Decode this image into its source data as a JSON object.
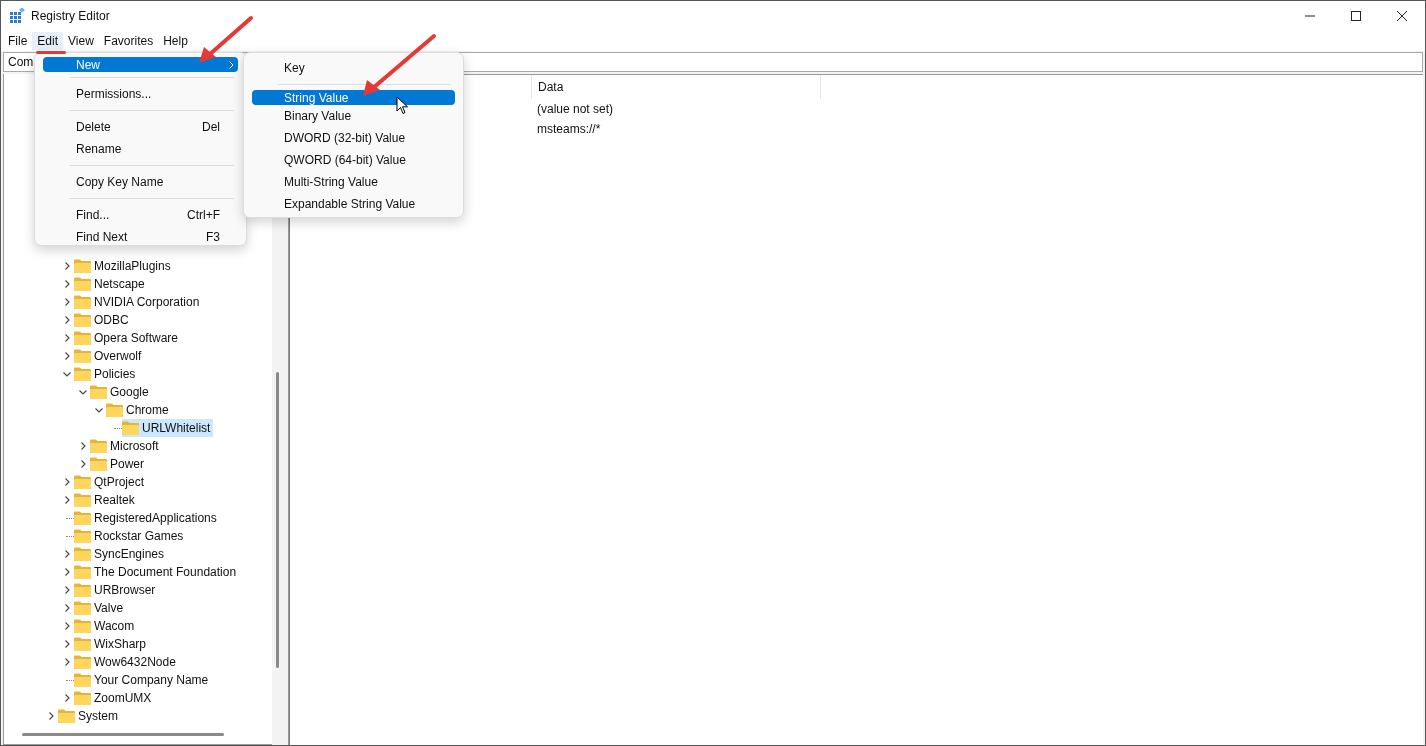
{
  "window": {
    "title": "Registry Editor"
  },
  "menu_bar": [
    {
      "label": "File",
      "selected": false
    },
    {
      "label": "Edit",
      "selected": true
    },
    {
      "label": "View",
      "selected": false
    },
    {
      "label": "Favorites",
      "selected": false
    },
    {
      "label": "Help",
      "selected": false
    }
  ],
  "address_bar": {
    "value": "Com"
  },
  "tree": [
    {
      "children": [
        {
          "label": "MozillaPlugins",
          "has_children": true,
          "expanded": false,
          "selected": false
        },
        {
          "label": "Netscape",
          "has_children": true,
          "expanded": false,
          "selected": false
        },
        {
          "label": "NVIDIA Corporation",
          "has_children": true,
          "expanded": false,
          "selected": false
        },
        {
          "label": "ODBC",
          "has_children": true,
          "expanded": false,
          "selected": false
        },
        {
          "label": "Opera Software",
          "has_children": true,
          "expanded": false,
          "selected": false
        },
        {
          "label": "Overwolf",
          "has_children": true,
          "expanded": false,
          "selected": false
        },
        {
          "label": "Policies",
          "has_children": true,
          "expanded": true,
          "selected": false,
          "children": [
            {
              "label": "Google",
              "has_children": true,
              "expanded": true,
              "selected": false,
              "children": [
                {
                  "label": "Chrome",
                  "has_children": true,
                  "expanded": true,
                  "selected": false,
                  "children": [
                    {
                      "label": "URLWhitelist",
                      "has_children": false,
                      "selected": true
                    }
                  ]
                }
              ]
            },
            {
              "label": "Microsoft",
              "has_children": true,
              "expanded": false,
              "selected": false
            },
            {
              "label": "Power",
              "has_children": true,
              "expanded": false,
              "selected": false
            }
          ]
        },
        {
          "label": "QtProject",
          "has_children": true,
          "expanded": false,
          "selected": false
        },
        {
          "label": "Realtek",
          "has_children": true,
          "expanded": false,
          "selected": false
        },
        {
          "label": "RegisteredApplications",
          "has_children": false,
          "selected": false
        },
        {
          "label": "Rockstar Games",
          "has_children": false,
          "selected": false
        },
        {
          "label": "SyncEngines",
          "has_children": true,
          "expanded": false,
          "selected": false
        },
        {
          "label": "The Document Foundation",
          "has_children": true,
          "expanded": false,
          "selected": false
        },
        {
          "label": "URBrowser",
          "has_children": true,
          "expanded": false,
          "selected": false
        },
        {
          "label": "Valve",
          "has_children": true,
          "expanded": false,
          "selected": false
        },
        {
          "label": "Wacom",
          "has_children": true,
          "expanded": false,
          "selected": false
        },
        {
          "label": "WixSharp",
          "has_children": true,
          "expanded": false,
          "selected": false
        },
        {
          "label": "Wow6432Node",
          "has_children": true,
          "expanded": false,
          "selected": false
        },
        {
          "label": "Your Company Name",
          "has_children": false,
          "selected": false
        },
        {
          "label": "ZoomUMX",
          "has_children": true,
          "expanded": false,
          "selected": false
        }
      ]
    },
    {
      "label": "System",
      "has_children": true,
      "expanded": false,
      "selected": false
    }
  ],
  "values_table": {
    "columns": [
      "Data"
    ],
    "rows": [
      {
        "data": "(value not set)"
      },
      {
        "data": "msteams://*"
      }
    ]
  },
  "edit_menu": [
    {
      "kind": "item",
      "label": "New",
      "submenu": true,
      "selected": true
    },
    {
      "kind": "separator"
    },
    {
      "kind": "item",
      "label": "Permissions...",
      "selected": false
    },
    {
      "kind": "separator"
    },
    {
      "kind": "item",
      "label": "Delete",
      "shortcut": "Del",
      "selected": false
    },
    {
      "kind": "item",
      "label": "Rename",
      "selected": false
    },
    {
      "kind": "separator"
    },
    {
      "kind": "item",
      "label": "Copy Key Name",
      "selected": false
    },
    {
      "kind": "separator"
    },
    {
      "kind": "item",
      "label": "Find...",
      "shortcut": "Ctrl+F",
      "selected": false
    },
    {
      "kind": "item",
      "label": "Find Next",
      "shortcut": "F3",
      "selected": false
    }
  ],
  "new_submenu": [
    {
      "kind": "item",
      "label": "Key",
      "selected": false
    },
    {
      "kind": "separator"
    },
    {
      "kind": "item",
      "label": "String Value",
      "selected": true
    },
    {
      "kind": "item",
      "label": "Binary Value",
      "selected": false
    },
    {
      "kind": "item",
      "label": "DWORD (32-bit) Value",
      "selected": false
    },
    {
      "kind": "item",
      "label": "QWORD (64-bit) Value",
      "selected": false
    },
    {
      "kind": "item",
      "label": "Multi-String Value",
      "selected": false
    },
    {
      "kind": "item",
      "label": "Expandable String Value",
      "selected": false
    }
  ]
}
